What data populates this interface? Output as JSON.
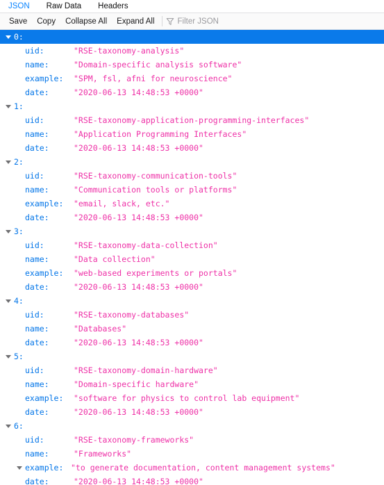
{
  "tabs": [
    {
      "label": "JSON",
      "active": true
    },
    {
      "label": "Raw Data",
      "active": false
    },
    {
      "label": "Headers",
      "active": false
    }
  ],
  "toolbar": {
    "save_label": "Save",
    "copy_label": "Copy",
    "collapse_all_label": "Collapse All",
    "expand_all_label": "Expand All",
    "filter_placeholder": "Filter JSON",
    "filter_value": "",
    "filter_icon": "funnel-icon"
  },
  "colors": {
    "key": "#0074e8",
    "string_value": "#ee2fa6",
    "selection": "#0a7aea",
    "active_tab": "#0a84ff",
    "placeholder": "#9a9a9e"
  },
  "json_rows": [
    {
      "type": "index",
      "label": "0:",
      "expanded": true,
      "selected": true
    },
    {
      "type": "prop",
      "key": "uid:",
      "value": "\"RSE-taxonomy-analysis\""
    },
    {
      "type": "prop",
      "key": "name:",
      "value": "\"Domain-specific analysis software\""
    },
    {
      "type": "prop",
      "key": "example:",
      "value": "\"SPM, fsl, afni for neuroscience\""
    },
    {
      "type": "prop",
      "key": "date:",
      "value": "\"2020-06-13 14:48:53 +0000\""
    },
    {
      "type": "index",
      "label": "1:",
      "expanded": true,
      "selected": false
    },
    {
      "type": "prop",
      "key": "uid:",
      "value": "\"RSE-taxonomy-application-programming-interfaces\""
    },
    {
      "type": "prop",
      "key": "name:",
      "value": "\"Application Programming Interfaces\""
    },
    {
      "type": "prop",
      "key": "date:",
      "value": "\"2020-06-13 14:48:53 +0000\""
    },
    {
      "type": "index",
      "label": "2:",
      "expanded": true,
      "selected": false
    },
    {
      "type": "prop",
      "key": "uid:",
      "value": "\"RSE-taxonomy-communication-tools\""
    },
    {
      "type": "prop",
      "key": "name:",
      "value": "\"Communication tools or platforms\""
    },
    {
      "type": "prop",
      "key": "example:",
      "value": "\"email, slack, etc.\""
    },
    {
      "type": "prop",
      "key": "date:",
      "value": "\"2020-06-13 14:48:53 +0000\""
    },
    {
      "type": "index",
      "label": "3:",
      "expanded": true,
      "selected": false
    },
    {
      "type": "prop",
      "key": "uid:",
      "value": "\"RSE-taxonomy-data-collection\""
    },
    {
      "type": "prop",
      "key": "name:",
      "value": "\"Data collection\""
    },
    {
      "type": "prop",
      "key": "example:",
      "value": "\"web-based experiments or portals\""
    },
    {
      "type": "prop",
      "key": "date:",
      "value": "\"2020-06-13 14:48:53 +0000\""
    },
    {
      "type": "index",
      "label": "4:",
      "expanded": true,
      "selected": false
    },
    {
      "type": "prop",
      "key": "uid:",
      "value": "\"RSE-taxonomy-databases\""
    },
    {
      "type": "prop",
      "key": "name:",
      "value": "\"Databases\""
    },
    {
      "type": "prop",
      "key": "date:",
      "value": "\"2020-06-13 14:48:53 +0000\""
    },
    {
      "type": "index",
      "label": "5:",
      "expanded": true,
      "selected": false
    },
    {
      "type": "prop",
      "key": "uid:",
      "value": "\"RSE-taxonomy-domain-hardware\""
    },
    {
      "type": "prop",
      "key": "name:",
      "value": "\"Domain-specific hardware\""
    },
    {
      "type": "prop",
      "key": "example:",
      "value": "\"software for physics to control lab equipment\""
    },
    {
      "type": "prop",
      "key": "date:",
      "value": "\"2020-06-13 14:48:53 +0000\""
    },
    {
      "type": "index",
      "label": "6:",
      "expanded": true,
      "selected": false
    },
    {
      "type": "prop",
      "key": "uid:",
      "value": "\"RSE-taxonomy-frameworks\""
    },
    {
      "type": "prop",
      "key": "name:",
      "value": "\"Frameworks\""
    },
    {
      "type": "prop",
      "key": "example:",
      "value": "\"to generate documentation, content management systems\"",
      "twisty": true
    },
    {
      "type": "prop",
      "key": "date:",
      "value": "\"2020-06-13 14:48:53 +0000\""
    }
  ]
}
